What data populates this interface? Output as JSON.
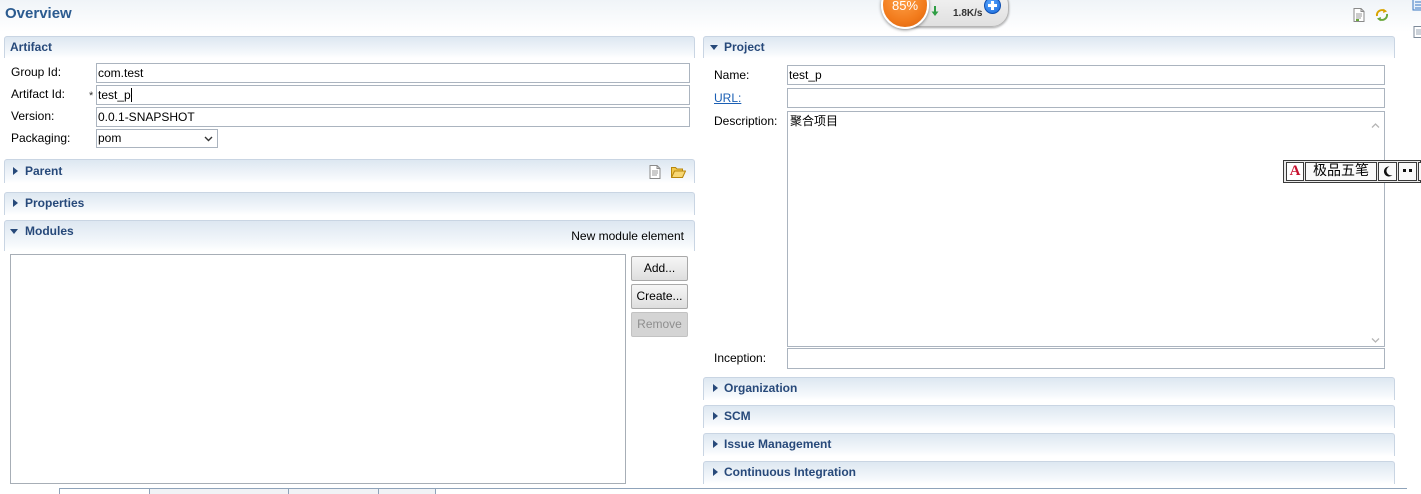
{
  "header": {
    "title": "Overview",
    "icons": [
      "document-icon",
      "refresh-icon"
    ]
  },
  "speed_widget": {
    "percent": "85%",
    "download_rate": "1.8K/s"
  },
  "artifact": {
    "title": "Artifact",
    "group_id": {
      "label": "Group Id:",
      "value": "com.test"
    },
    "artifact_id": {
      "label": "Artifact Id:",
      "marker": "*",
      "value": "test_p"
    },
    "version": {
      "label": "Version:",
      "value": "0.0.1-SNAPSHOT"
    },
    "packaging": {
      "label": "Packaging:",
      "value": "pom"
    }
  },
  "parent": {
    "title": "Parent",
    "icons": [
      "document-icon",
      "open-folder-icon"
    ]
  },
  "properties": {
    "title": "Properties"
  },
  "modules": {
    "title": "Modules",
    "description": "New module element",
    "buttons": {
      "add": "Add...",
      "create": "Create...",
      "remove": "Remove"
    }
  },
  "project": {
    "title": "Project",
    "name": {
      "label": "Name:",
      "value": "test_p"
    },
    "url": {
      "label": "URL:"
    },
    "description": {
      "label": "Description:",
      "value": "聚合项目"
    },
    "inception": {
      "label": "Inception:"
    }
  },
  "collapsed_sections": [
    "Organization",
    "SCM",
    "Issue Management",
    "Continuous Integration"
  ],
  "ime_bar": {
    "mode_label": "A",
    "input_method": "极品五笔",
    "icons": [
      "half-width-moon-icon",
      "punctuation-icon",
      "soft-keyboard-icon"
    ]
  },
  "colors": {
    "section_title": "#27497a",
    "page_title": "#2b5b90",
    "link": "#1a5fb4",
    "speed_ball": "#f27b1c",
    "disabled_button": "#d4d4d4"
  }
}
